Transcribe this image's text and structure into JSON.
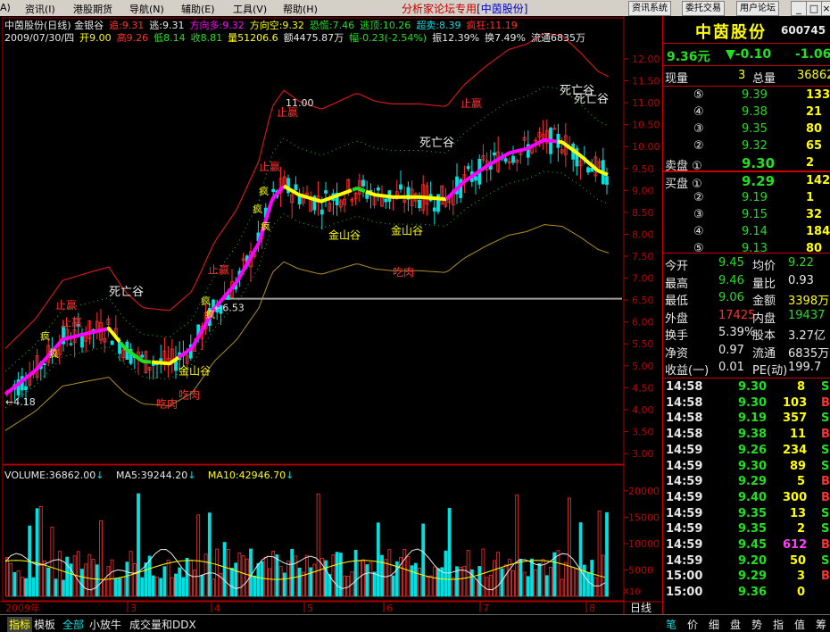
{
  "menu": {
    "items": [
      "A)",
      "资讯(I)",
      "港股期货",
      "导航(N)",
      "辅助(E)",
      "工具(V)",
      "帮助(H)"
    ],
    "forum_text": "分析家论坛专用",
    "forum_stock": "[中茵股份]",
    "buttons": [
      "资讯系统",
      "委托交易",
      "用户论坛"
    ],
    "window_buttons": [
      "_",
      "□",
      "×"
    ]
  },
  "indicator_header": {
    "row1": [
      {
        "text": "中茵股份(日线) 金银谷",
        "color": "#e8e8e8"
      },
      {
        "text": "追:9.31",
        "color": "#ff3030"
      },
      {
        "text": "逃:9.31",
        "color": "#e8e8e8"
      },
      {
        "text": "方向多:9.32",
        "color": "#ff00ff"
      },
      {
        "text": "方向空:9.32",
        "color": "#ffff00"
      },
      {
        "text": "恐慌:7.46",
        "color": "#20e020"
      },
      {
        "text": "逃顶:10.26",
        "color": "#20e020"
      },
      {
        "text": "超卖:8.39",
        "color": "#00e0e0"
      },
      {
        "text": "疯狂:11.19",
        "color": "#ff3030"
      }
    ],
    "row2": [
      {
        "text": "2009/07/30/四",
        "color": "#e8e8e8"
      },
      {
        "text": "开9.00",
        "color": "#ffff00"
      },
      {
        "text": "高9.26",
        "color": "#ff3030"
      },
      {
        "text": "低8.14",
        "color": "#20e020"
      },
      {
        "text": "收8.81",
        "color": "#20e020"
      },
      {
        "text": "量51206.6",
        "color": "#ffff00"
      },
      {
        "text": "额4475.87万",
        "color": "#e8e8e8"
      },
      {
        "text": "幅-0.23(-2.54%)",
        "color": "#20e020"
      },
      {
        "text": "振12.39%",
        "color": "#e8e8e8"
      },
      {
        "text": "换7.49%",
        "color": "#e8e8e8"
      },
      {
        "text": "流通6835万",
        "color": "#e8e8e8"
      }
    ]
  },
  "price_axis": [
    "12.00",
    "11.50",
    "11.00",
    "10.50",
    "10.00",
    "9.50",
    "9.00",
    "8.50",
    "8.00",
    "7.50",
    "7.00",
    "6.50",
    "6.00",
    "5.50",
    "5.00",
    "4.50",
    "4.00",
    "3.50",
    "3.00"
  ],
  "annotations": {
    "low_label": "←4.18",
    "high_label": "11.00",
    "mid_label": "←6.53",
    "death_valley": "死亡谷",
    "gold_valley": "金山谷",
    "eat_meat": "吃肉",
    "stop_gain": "止赢",
    "crazy": "疯"
  },
  "volume_header": {
    "vol": "VOLUME:36862.00",
    "ma5": "MA5:39244.20",
    "ma10": "MA10:42946.70"
  },
  "volume_axis": [
    "20000",
    "15000",
    "10000",
    "5000"
  ],
  "volume_unit": "X10",
  "date_axis": {
    "year": "2009年",
    "months": [
      "3",
      "4",
      "5",
      "6",
      "7",
      "8"
    ],
    "period": "日线"
  },
  "bottom_tabs": [
    "指标",
    "模板",
    "全部",
    "小放牛",
    "成交量和DDX"
  ],
  "right_tabs": [
    "笔",
    "价",
    "细",
    "盘",
    "势",
    "指",
    "值",
    "筹"
  ],
  "stock": {
    "name": "中茵股份",
    "code": "600745",
    "price": "9.36元",
    "change": "▼-0.10",
    "change_pct": "-1.06"
  },
  "quote_top": {
    "label_now": "现量",
    "now": "3",
    "label_total": "总量",
    "total": "36862"
  },
  "sell_orders": [
    {
      "label": "⑤",
      "price": "9.39",
      "vol": "133"
    },
    {
      "label": "④",
      "price": "9.38",
      "vol": "21"
    },
    {
      "label": "③",
      "price": "9.35",
      "vol": "80"
    },
    {
      "label": "②",
      "price": "9.32",
      "vol": "65"
    },
    {
      "label": "卖盘 ①",
      "price": "9.30",
      "vol": "2"
    }
  ],
  "buy_orders": [
    {
      "label": "买盘 ①",
      "price": "9.29",
      "vol": "142"
    },
    {
      "label": "②",
      "price": "9.19",
      "vol": "1"
    },
    {
      "label": "③",
      "price": "9.15",
      "vol": "32"
    },
    {
      "label": "④",
      "price": "9.14",
      "vol": "184"
    },
    {
      "label": "⑤",
      "price": "9.13",
      "vol": "80"
    }
  ],
  "stats": [
    {
      "l1": "今开",
      "v1": "9.45",
      "c1": "#20e020",
      "l2": "均价",
      "v2": "9.22",
      "c2": "#20e020"
    },
    {
      "l1": "最高",
      "v1": "9.46",
      "c1": "#20e020",
      "l2": "量比",
      "v2": "0.93",
      "c2": "#e8e8e8"
    },
    {
      "l1": "最低",
      "v1": "9.06",
      "c1": "#20e020",
      "l2": "金额",
      "v2": "3398万",
      "c2": "#ffff00"
    },
    {
      "l1": "外盘",
      "v1": "17425",
      "c1": "#ff3030",
      "l2": "内盘",
      "v2": "19437",
      "c2": "#20e020"
    },
    {
      "l1": "换手",
      "v1": "5.39%",
      "c1": "#e8e8e8",
      "l2": "股本",
      "v2": "3.27亿",
      "c2": "#e8e8e8"
    },
    {
      "l1": "净资",
      "v1": "0.97",
      "c1": "#e8e8e8",
      "l2": "流通",
      "v2": "6835万",
      "c2": "#e8e8e8"
    },
    {
      "l1": "收益(一)",
      "v1": "0.01",
      "c1": "#e8e8e8",
      "l2": "PE(动)",
      "v2": "199.7",
      "c2": "#e8e8e8"
    }
  ],
  "ticks": [
    {
      "time": "14:58",
      "price": "9.30",
      "vol": "8",
      "side": "S",
      "pc": "#20e020",
      "vc": "#ffff00"
    },
    {
      "time": "14:58",
      "price": "9.30",
      "vol": "103",
      "side": "B",
      "pc": "#20e020",
      "vc": "#ffff00"
    },
    {
      "time": "14:58",
      "price": "9.19",
      "vol": "357",
      "side": "S",
      "pc": "#20e020",
      "vc": "#ffff00"
    },
    {
      "time": "14:58",
      "price": "9.38",
      "vol": "11",
      "side": "B",
      "pc": "#20e020",
      "vc": "#ffff00"
    },
    {
      "time": "14:59",
      "price": "9.26",
      "vol": "234",
      "side": "S",
      "pc": "#20e020",
      "vc": "#ffff00"
    },
    {
      "time": "14:59",
      "price": "9.30",
      "vol": "89",
      "side": "S",
      "pc": "#20e020",
      "vc": "#ffff00"
    },
    {
      "time": "14:59",
      "price": "9.29",
      "vol": "5",
      "side": "B",
      "pc": "#20e020",
      "vc": "#ffff00"
    },
    {
      "time": "14:59",
      "price": "9.40",
      "vol": "300",
      "side": "B",
      "pc": "#20e020",
      "vc": "#ffff00"
    },
    {
      "time": "14:59",
      "price": "9.35",
      "vol": "13",
      "side": "S",
      "pc": "#20e020",
      "vc": "#ffff00"
    },
    {
      "time": "14:59",
      "price": "9.35",
      "vol": "2",
      "side": "S",
      "pc": "#20e020",
      "vc": "#ffff00"
    },
    {
      "time": "14:59",
      "price": "9.45",
      "vol": "612",
      "side": "B",
      "pc": "#20e020",
      "vc": "#ff40ff"
    },
    {
      "time": "14:59",
      "price": "9.20",
      "vol": "50",
      "side": "S",
      "pc": "#20e020",
      "vc": "#ffff00"
    },
    {
      "time": "15:00",
      "price": "9.29",
      "vol": "3",
      "side": "B",
      "pc": "#20e020",
      "vc": "#ffff00"
    },
    {
      "time": "15:00",
      "price": "9.36",
      "vol": "0",
      "side": "",
      "pc": "#20e020",
      "vc": "#ffff00"
    }
  ]
}
